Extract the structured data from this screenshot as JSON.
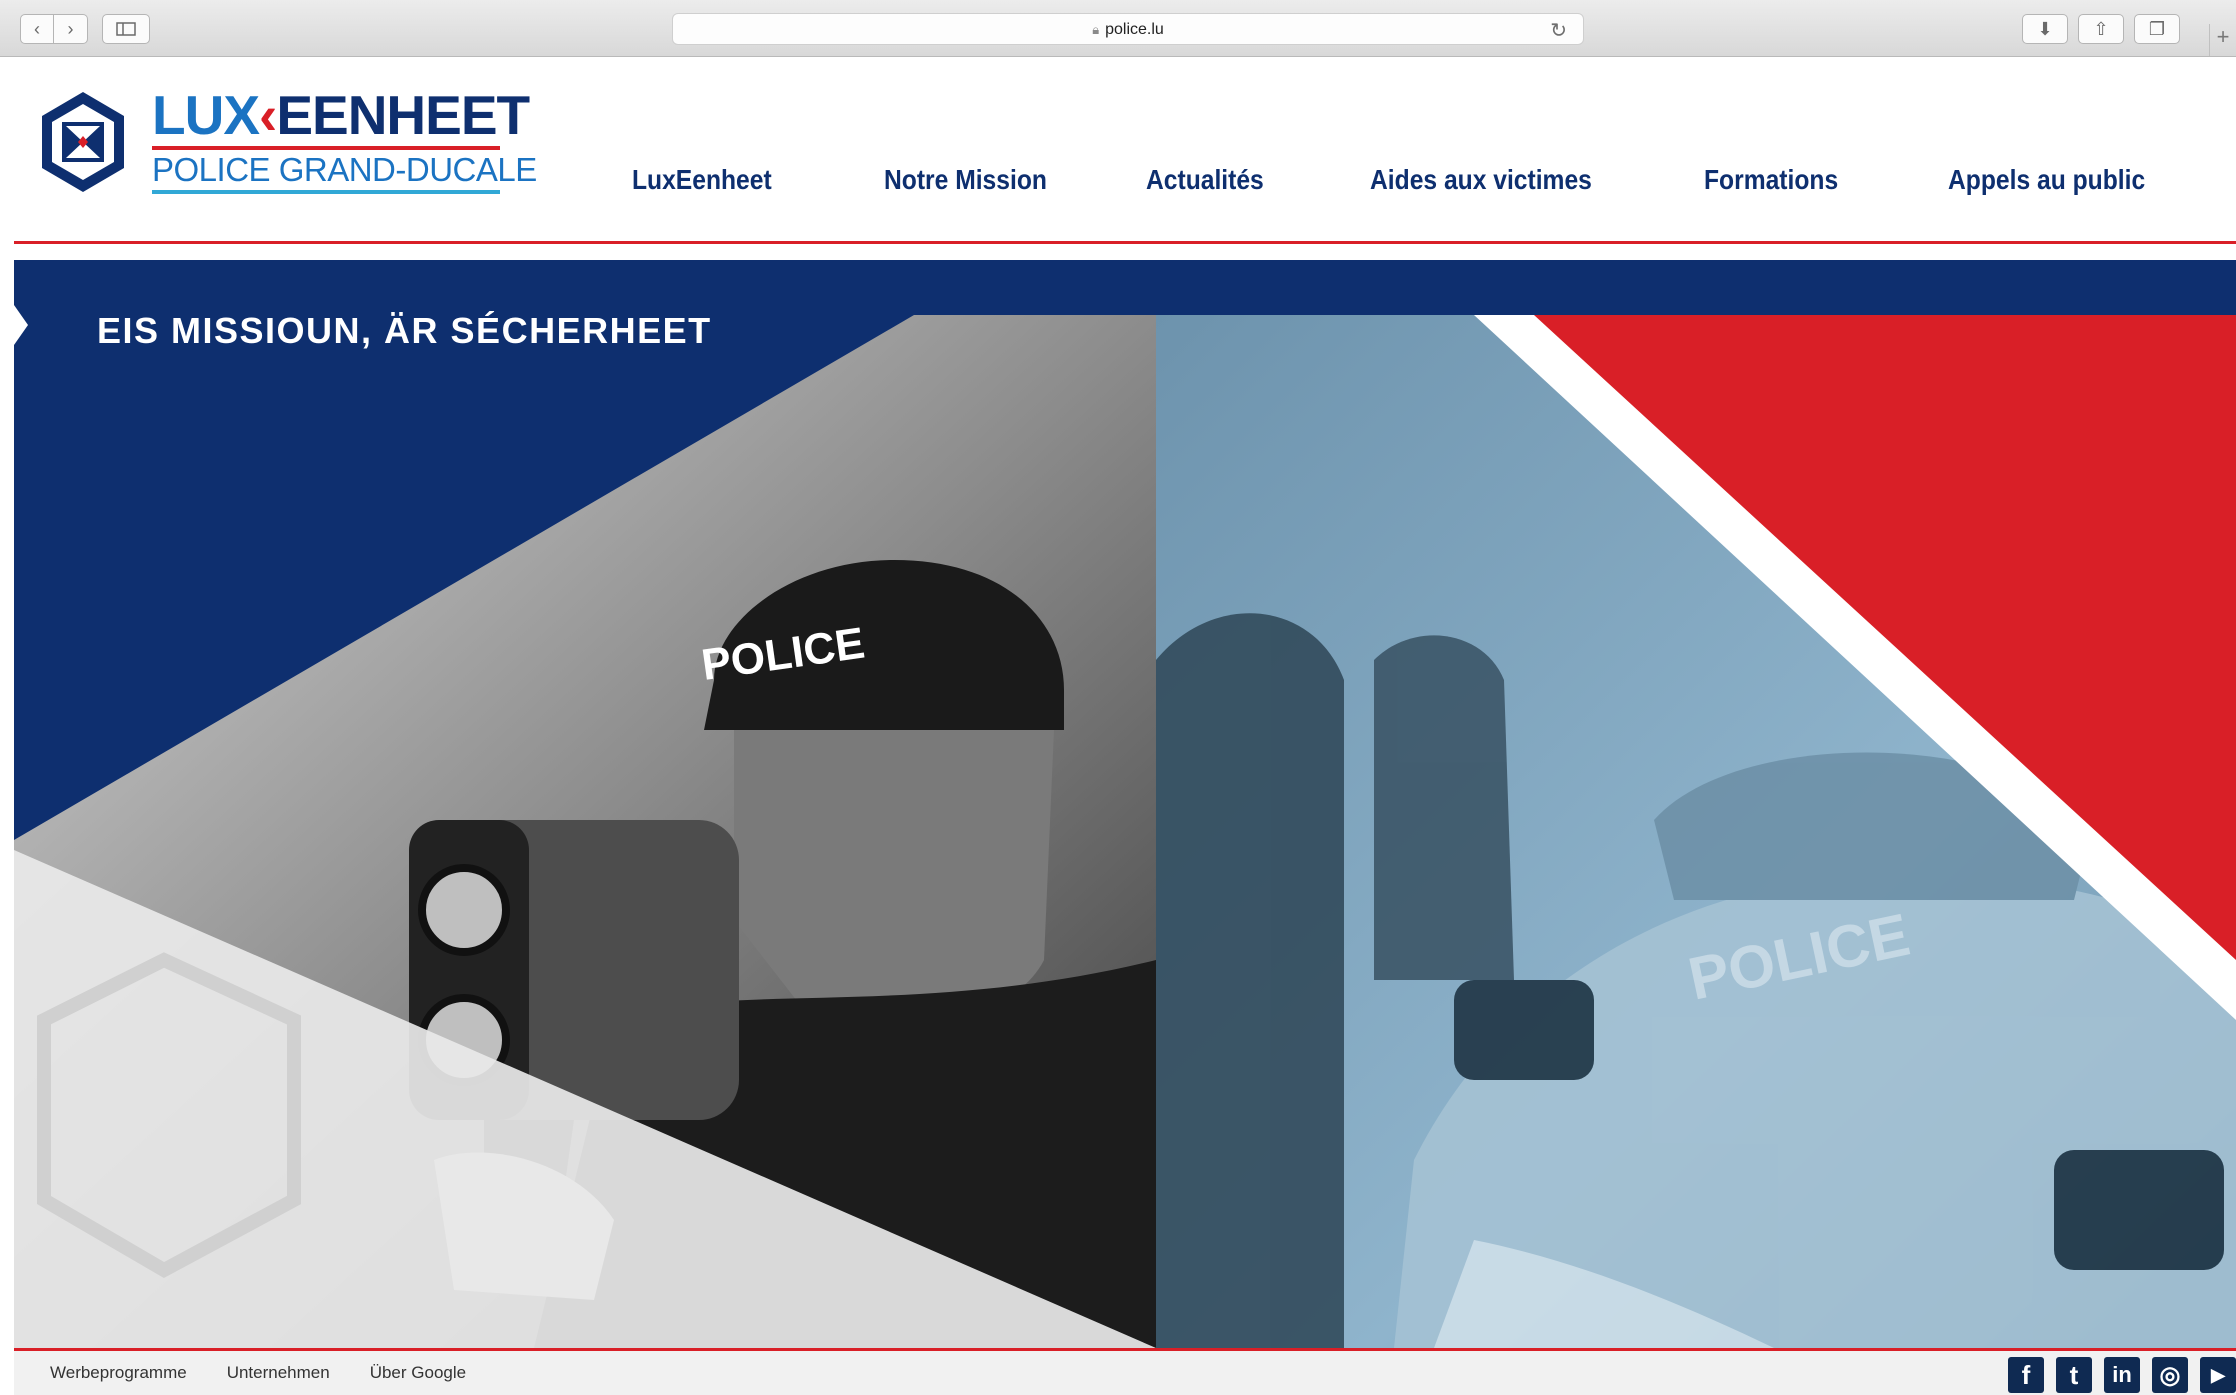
{
  "browser": {
    "url": "police.lu",
    "back_icon": "chevron-left-icon",
    "forward_icon": "chevron-right-icon"
  },
  "brand": {
    "name_part1": "LUX",
    "name_part2": "EENHEET",
    "subtitle": "POLICE GRAND-DUCALE",
    "colors": {
      "navy": "#0e2f6f",
      "blue": "#1b73c2",
      "red": "#d91f27",
      "cyan": "#31a8d6"
    }
  },
  "nav": {
    "items": [
      {
        "label": "LuxEenheet"
      },
      {
        "label": "Notre Mission"
      },
      {
        "label": "Actualités"
      },
      {
        "label": "Aides aux victimes"
      },
      {
        "label": "Formations"
      },
      {
        "label": "Appels au public"
      }
    ]
  },
  "hero": {
    "title": "EIS MISSIOUN, ÄR SÉCHERHEET",
    "photo_left_text": "POLICE",
    "photo_right_text": "POLICE"
  },
  "statusbar": {
    "links": [
      "Werbeprogramme",
      "Unternehmen",
      "Über Google"
    ]
  },
  "social": [
    {
      "glyph": "f",
      "icon": "facebook-icon"
    },
    {
      "glyph": "t",
      "icon": "tumblr-icon"
    },
    {
      "glyph": "in",
      "icon": "linkedin-icon"
    },
    {
      "glyph": "◎",
      "icon": "instagram-icon"
    },
    {
      "glyph": "▶",
      "icon": "youtube-icon"
    }
  ]
}
